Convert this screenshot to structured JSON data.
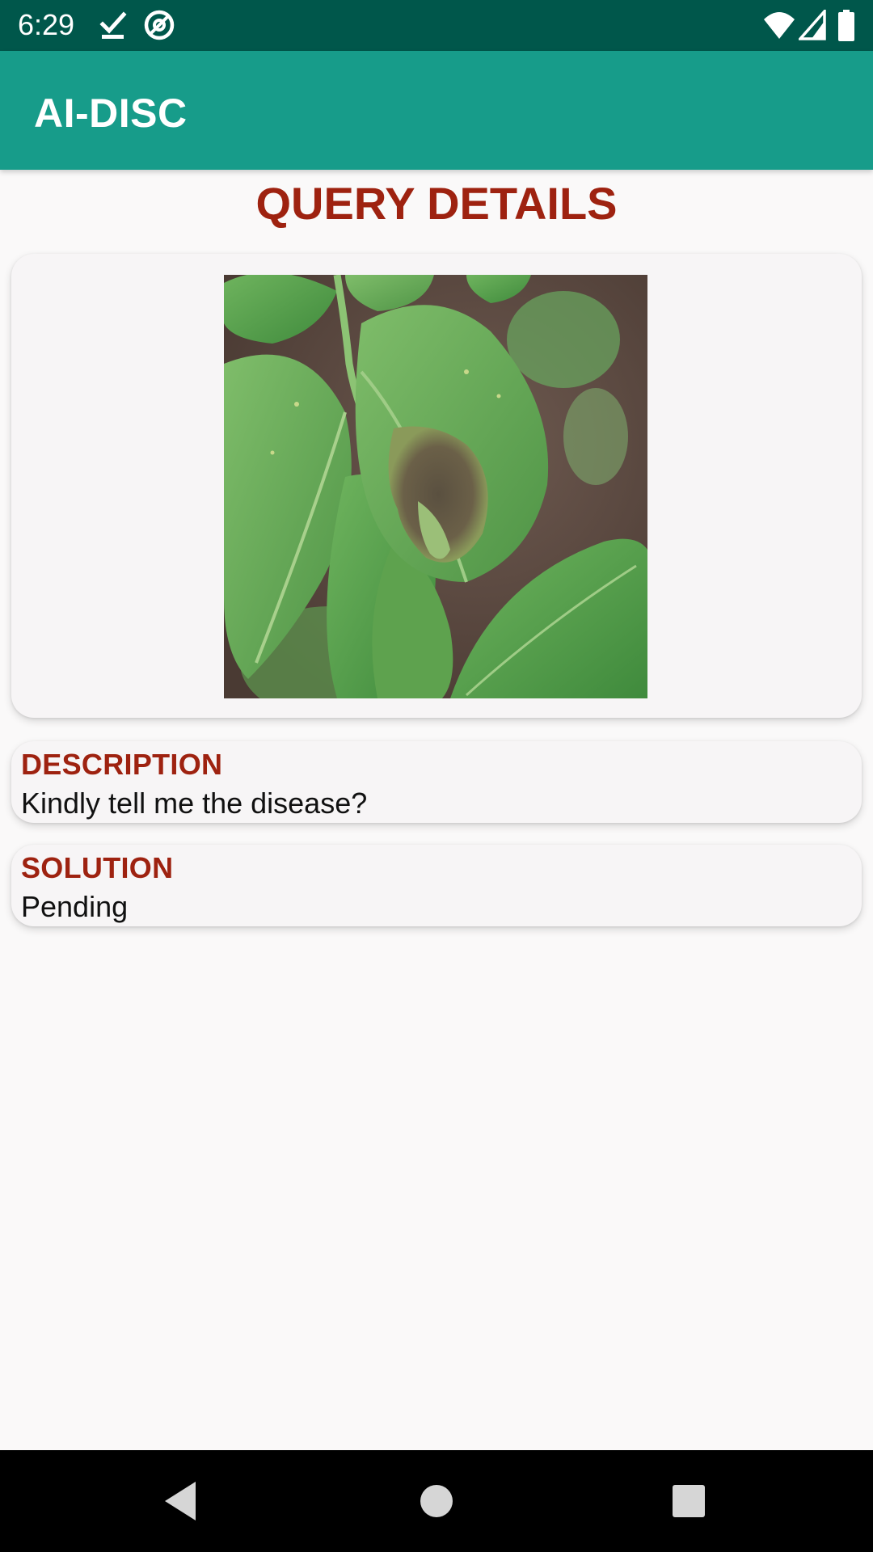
{
  "status_bar": {
    "time": "6:29",
    "icons": [
      "download-done-icon",
      "at-sign-icon",
      "wifi-icon",
      "signal-icon",
      "battery-icon"
    ]
  },
  "app_bar": {
    "title": "AI-DISC",
    "color": "#179c8a"
  },
  "page": {
    "title": "QUERY DETAILS",
    "accent_color": "#9e2210"
  },
  "query": {
    "image_icon": "leaf-photo",
    "description_label": "DESCRIPTION",
    "description": "Kindly tell me the disease?",
    "solution_label": "SOLUTION",
    "solution": "Pending"
  },
  "nav_bar": {
    "buttons": [
      "back-icon",
      "home-icon",
      "recents-icon"
    ]
  }
}
